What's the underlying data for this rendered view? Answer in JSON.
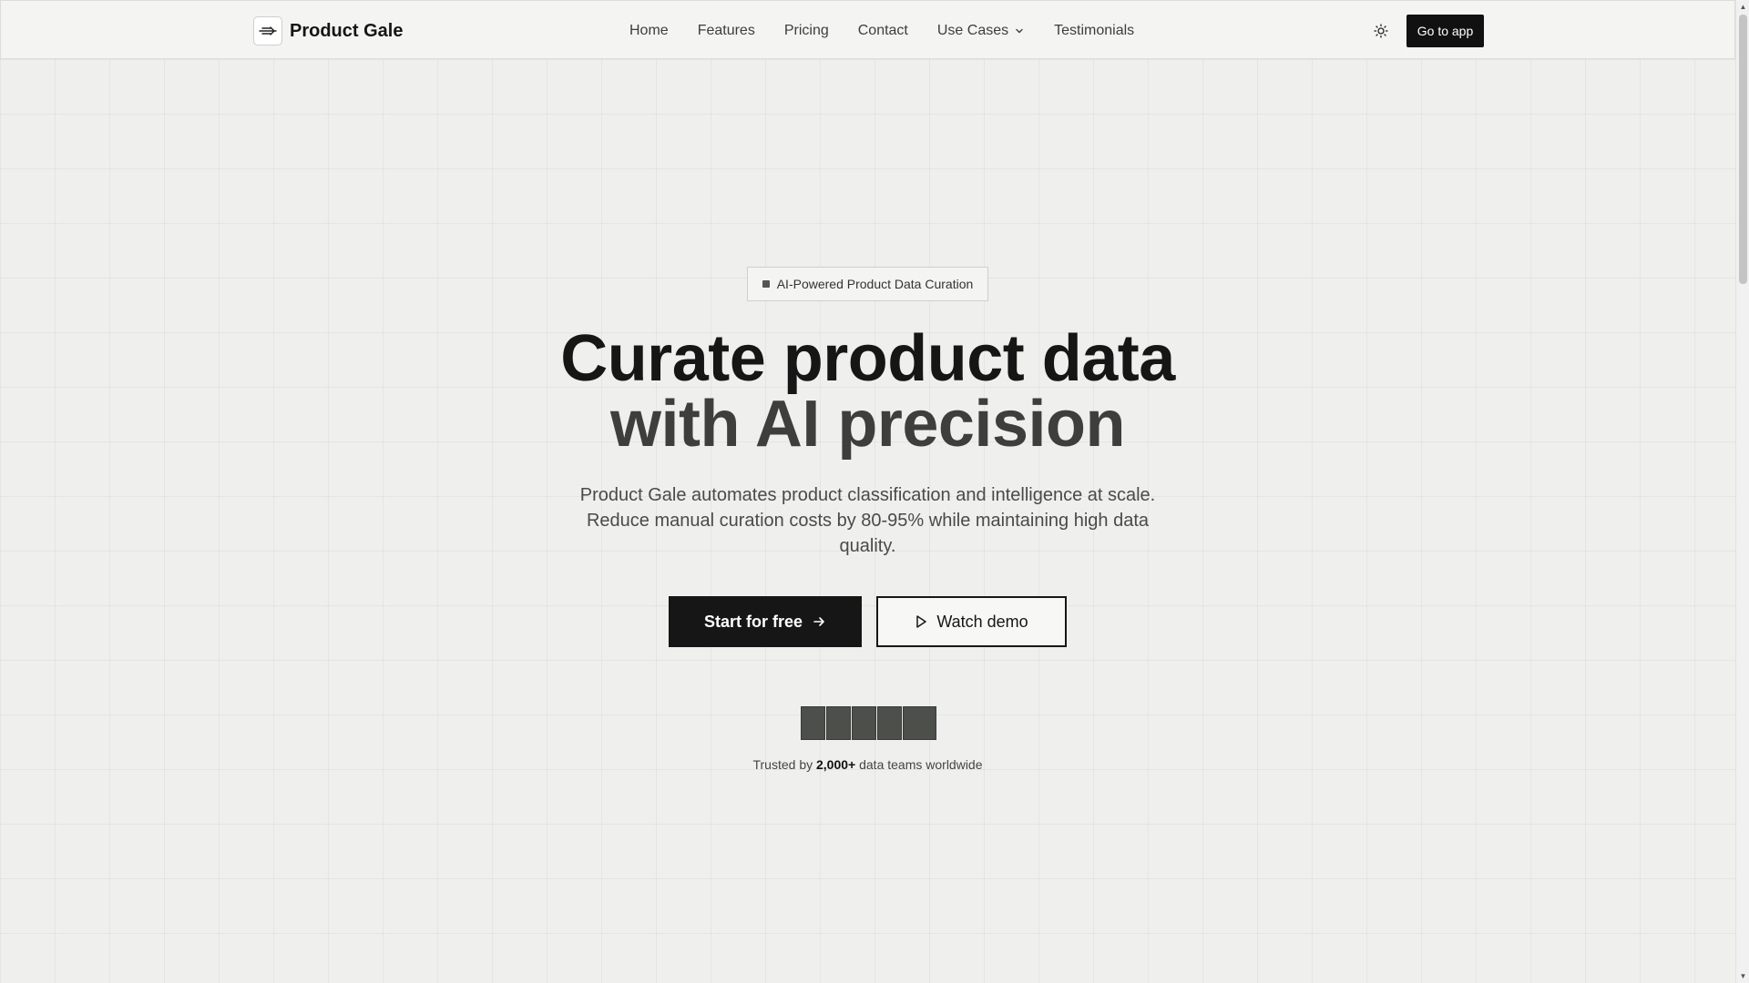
{
  "header": {
    "brand": "Product Gale",
    "nav": [
      "Home",
      "Features",
      "Pricing",
      "Contact",
      "Use Cases",
      "Testimonials"
    ],
    "go_app_label": "Go to app"
  },
  "hero": {
    "badge": "AI-Powered Product Data Curation",
    "headline_line1": "Curate product data",
    "headline_line2": "with AI precision",
    "subtext": "Product Gale automates product classification and intelligence at scale. Reduce manual curation costs by 80-95% while maintaining high data quality.",
    "primary_cta": "Start for free",
    "secondary_cta": "Watch demo",
    "trusted_prefix": "Trusted by ",
    "trusted_count": "2,000+",
    "trusted_suffix": " data teams worldwide"
  },
  "icons": {
    "logo": "wind-logo-icon",
    "theme": "sun-icon",
    "dropdown": "chevron-down-icon",
    "arrow": "arrow-right-icon",
    "play": "play-icon"
  },
  "colors": {
    "background": "#efefed",
    "primary": "#161616",
    "text_muted": "#4a4a4a"
  }
}
